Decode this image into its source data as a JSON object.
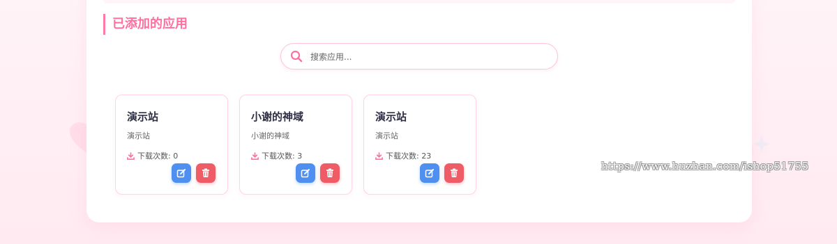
{
  "section": {
    "title": "已添加的应用"
  },
  "search": {
    "placeholder": "搜索应用...",
    "value": ""
  },
  "cards": [
    {
      "name": "演示站",
      "desc": "演示站",
      "downloads": "下载次数: 0"
    },
    {
      "name": "小谢的神域",
      "desc": "小谢的神域",
      "downloads": "下载次数: 3"
    },
    {
      "name": "演示站",
      "desc": "演示站",
      "downloads": "下载次数: 23"
    }
  ],
  "icons": {
    "search": "search-icon",
    "download": "download-icon",
    "edit": "edit-icon",
    "delete": "trash-icon"
  },
  "colors": {
    "accent": "#ff6fa0",
    "edit": "#4e8ff0",
    "delete": "#f05c66"
  },
  "watermark": "https://www.huzhan.com/ishop51755"
}
